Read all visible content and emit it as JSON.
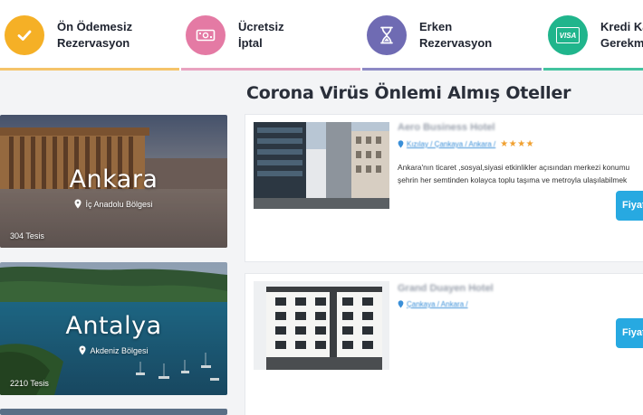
{
  "features": [
    {
      "label": "Ön Ödemesiz\nRezervasyon",
      "icon": "check-icon",
      "icon_color": "#f5b026",
      "line_color": "#f5c46a"
    },
    {
      "label": "Ücretsiz\nİptal",
      "icon": "money-icon",
      "icon_color": "#e47aa4",
      "line_color": "#e9a3c0"
    },
    {
      "label": "Erken\nRezervasyon",
      "icon": "hourglass-icon",
      "icon_color": "#6f6bb3",
      "line_color": "#8d89c5"
    },
    {
      "label": "Kredi Kartı\nGerekmez",
      "icon": "visa-card-icon",
      "icon_color": "#20b58c",
      "line_color": "#43c39f",
      "icon_text": "VISA"
    }
  ],
  "heading": "Corona Virüs Önlemi Almış Oteller",
  "cities": [
    {
      "name": "Ankara",
      "region": "İç Anadolu Bölgesi",
      "count": "304 Tesis"
    },
    {
      "name": "Antalya",
      "region": "Akdeniz Bölgesi",
      "count": "2210 Tesis"
    }
  ],
  "hotels": [
    {
      "name": "Aero Business Hotel",
      "location": "Kızılay / Çankaya / Ankara /",
      "stars": "★★★★",
      "desc_line1": "Ankara'nın ticaret ,sosyal,siyasi etkinlikler açısından merkezi konumu",
      "desc_line2": "şehrin her semtinden kolayca toplu taşıma ve metroyla ulaşılabilmek",
      "button": "Fiyat"
    },
    {
      "name": "Grand Duayen Hotel",
      "location": "Çankaya / Ankara /",
      "button": "Fiyat"
    }
  ]
}
